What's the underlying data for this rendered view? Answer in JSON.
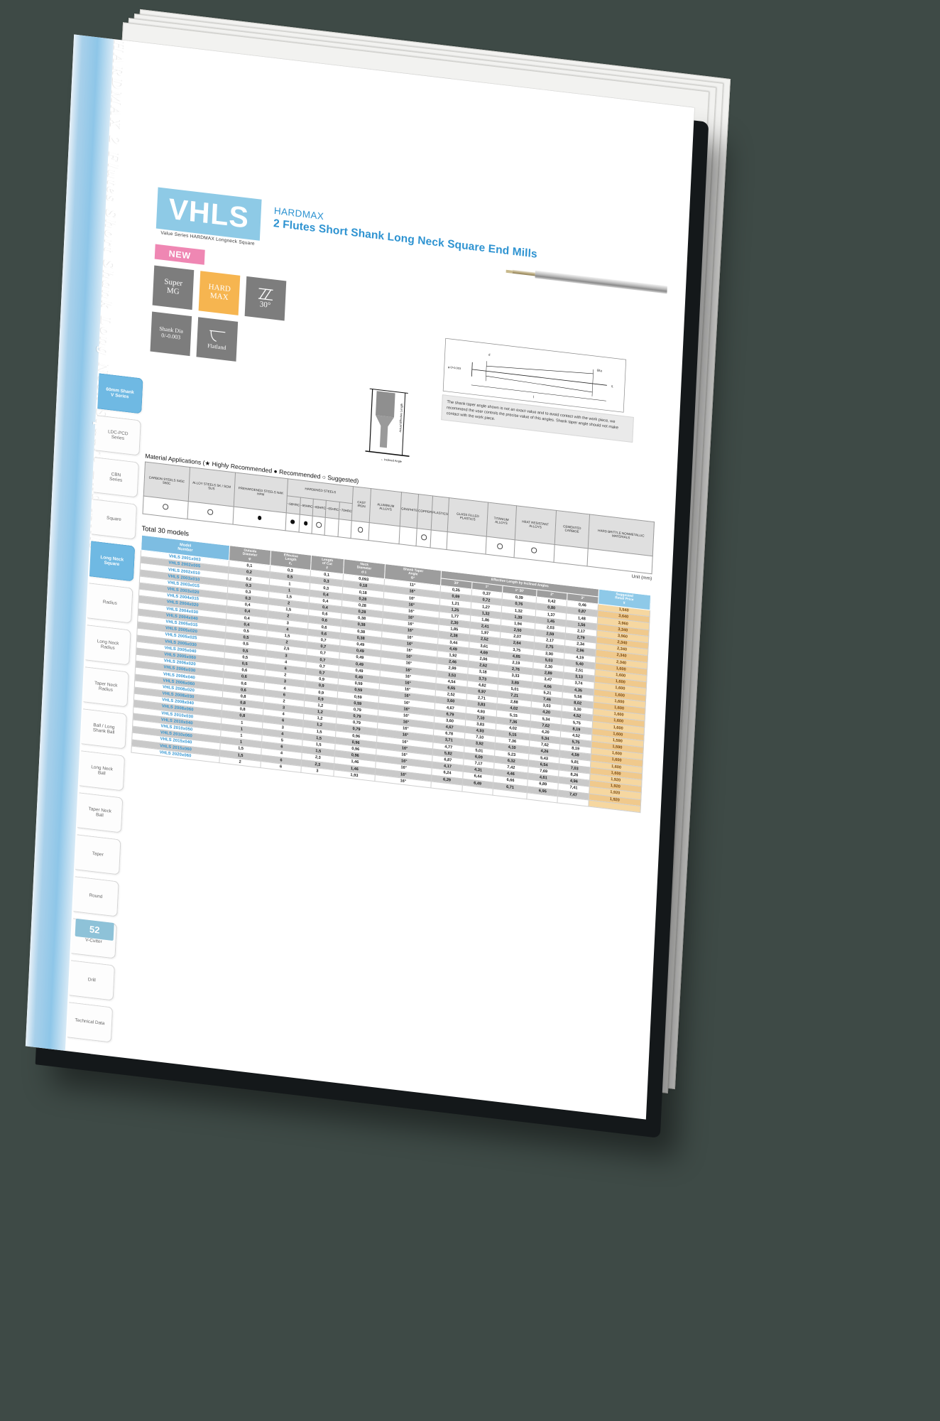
{
  "spine": {
    "text": "HARDMAX 2 Flutes Short Shank Long Neck Square End Mills"
  },
  "page_number": "52",
  "sidebar": {
    "group_labels": [
      "Square",
      "Radius",
      "Ball",
      "Taper"
    ],
    "tabs": [
      {
        "label": "60mm Shank\nV Series",
        "active": true
      },
      {
        "label": "LDC-PCD\nSeries",
        "active": false
      },
      {
        "label": "CBN\nSeries",
        "active": false
      },
      {
        "label": "Square",
        "active": false
      },
      {
        "label": "Long Neck\nSquare",
        "active": true
      },
      {
        "label": "Radius",
        "active": false
      },
      {
        "label": "Long Neck\nRadius",
        "active": false
      },
      {
        "label": "Taper Neck\nRadius",
        "active": false
      },
      {
        "label": "Ball / Long\nShank Ball",
        "active": false
      },
      {
        "label": "Long Neck\nBall",
        "active": false
      },
      {
        "label": "Taper Neck\nBall",
        "active": false
      },
      {
        "label": "Taper",
        "active": false
      },
      {
        "label": "Round",
        "active": false
      },
      {
        "label": "Corner\nV-Cutter",
        "active": false
      },
      {
        "label": "Drill",
        "active": false
      },
      {
        "label": "Technical Data",
        "active": false
      }
    ]
  },
  "header": {
    "logo": "VHLS",
    "logo_sub": "Value Series HARDMAX Longneck Square",
    "brand": "HARDMAX",
    "title": "2 Flutes Short Shank Long Neck Square End Mills",
    "new_badge": "NEW",
    "badges": [
      {
        "name": "super-mg",
        "line1": "Super",
        "line2": "MG",
        "style": "gray"
      },
      {
        "name": "hard-max",
        "line1": "HARD",
        "line2": "MAX",
        "style": "orange"
      },
      {
        "name": "helix-angle",
        "line1": "",
        "line2": "30°",
        "style": "gray",
        "icon": "helix-icon"
      },
      {
        "name": "shank-dia",
        "line1": "Shank Dia",
        "line2": "0/-0.003",
        "style": "gray"
      },
      {
        "name": "flatland",
        "line1": "",
        "line2": "Flatland",
        "style": "gray",
        "icon": "flatland-icon"
      }
    ]
  },
  "diagram": {
    "tool_label": "Actual Effective Length",
    "inclined_label": "Inclined Angle",
    "note": "The shank taper angle shown is not an exact value and to avoid contact with the work piece, we recommend the user controls the precise value of this angles. Shank taper angle should not make contact with the work piece.",
    "dim_d": "d",
    "dim_l1": "l1",
    "dim_l": "l",
    "dim_phi": "φ 0/-0.003",
    "dim_theta": "Θta"
  },
  "material_applications": {
    "title": "Material Applications  (★ Highly Recommended    ● Recommended    ○ Suggested)",
    "legend": [
      {
        "symbol": "★",
        "label": "Highly Recommended"
      },
      {
        "symbol": "●",
        "label": "Recommended"
      },
      {
        "symbol": "○",
        "label": "Suggested"
      }
    ],
    "group_header": "HARDENED STEELS",
    "columns": [
      "CARBON STEELS S45C S50C",
      "ALLOY STEELS SK / SCM SUS",
      "PREHARDENED STEELS NAK HPM",
      "~50HRC",
      "~55HRC",
      "~60HRC",
      "~65HRC",
      "~70HRC",
      "CAST IRON",
      "ALUMINUM ALLOYS",
      "GRAPHITE",
      "COPPER",
      "PLASTICS",
      "GLASS FILLED PLASTICS",
      "TITANIUM ALLOYS",
      "HEAT RESISTANT ALLOYS",
      "CEMENTED CARBIDE",
      "HARD BRITTLE NONMETALLIC MATERIALS"
    ],
    "ratings": [
      "○",
      "○",
      "●",
      "●",
      "●",
      "○",
      "",
      "",
      "○",
      "",
      "",
      "○",
      "",
      "",
      "○",
      "○",
      "",
      ""
    ]
  },
  "unit_note": "Unit  (mm)",
  "total_models": "Total 30 models",
  "table": {
    "headers": {
      "model": "Model\nNumber",
      "outside_diameter": "Outside\nDiameter\nφ",
      "effective_length": "Effective\nLength\nℓ₁",
      "length_of_cut": "Length\nof Cut\nℓ",
      "neck_diameter": "Neck\nDiameter\nd·1",
      "shank_taper_angle": "Shank Taper\nAngle\nΘ°",
      "eff_length_group": "Effective Length by Inclined Angles",
      "angles": [
        "30'",
        "1°",
        "1° 30'",
        "2°",
        "3°"
      ],
      "price": "Suggested\nRetail Price\n¥"
    },
    "rows": [
      {
        "model": "VHLS 2001x003",
        "od": "0,1",
        "el": "0,3",
        "loc": "0,1",
        "nd": "0,093",
        "sta": "11°",
        "a": [
          "0,35",
          "0,37",
          "0,39",
          "0,42",
          "0,46"
        ],
        "price": "1,540"
      },
      {
        "model": "VHLS 2002x005",
        "od": "0,2",
        "el": "0,5",
        "loc": "0,3",
        "nd": "0,18",
        "sta": "16°",
        "a": [
          "0,69",
          "0,72",
          "0,76",
          "0,80",
          "0,87"
        ],
        "price": "3,640"
      },
      {
        "model": "VHLS 2002x010",
        "od": "0,2",
        "el": "1",
        "loc": "0,3",
        "nd": "0,18",
        "sta": "16°",
        "a": [
          "1,21",
          "1,27",
          "1,32",
          "1,37",
          "1,48"
        ],
        "price": "3,960"
      },
      {
        "model": "VHLS 2003x010",
        "od": "0,3",
        "el": "1",
        "loc": "0,4",
        "nd": "0,28",
        "sta": "16°",
        "a": [
          "1,25",
          "1,32",
          "1,39",
          "1,45",
          "1,56"
        ],
        "price": "3,340"
      },
      {
        "model": "VHLS 2003x015",
        "od": "0,3",
        "el": "1,5",
        "loc": "0,4",
        "nd": "0,28",
        "sta": "16°",
        "a": [
          "1,77",
          "1,86",
          "1,94",
          "2,03",
          "2,17"
        ],
        "price": "3,960"
      },
      {
        "model": "VHLS 2003x020",
        "od": "0,3",
        "el": "2",
        "loc": "0,4",
        "nd": "0,28",
        "sta": "16°",
        "a": [
          "2,30",
          "2,41",
          "2,50",
          "2,59",
          "2,79"
        ],
        "price": "2,340"
      },
      {
        "model": "VHLS 2004x015",
        "od": "0,4",
        "el": "1,5",
        "loc": "0,6",
        "nd": "0,38",
        "sta": "16°",
        "a": [
          "1,85",
          "1,97",
          "2,07",
          "2,17",
          "2,34"
        ],
        "price": "2,340"
      },
      {
        "model": "VHLS 2004x020",
        "od": "0,4",
        "el": "2",
        "loc": "0,6",
        "nd": "0,38",
        "sta": "16°",
        "a": [
          "2,38",
          "2,52",
          "2,64",
          "2,75",
          "2,96"
        ],
        "price": "2,340"
      },
      {
        "model": "VHLS 2004x030",
        "od": "0,4",
        "el": "3",
        "loc": "0,6",
        "nd": "0,38",
        "sta": "16°",
        "a": [
          "3,44",
          "3,61",
          "3,75",
          "3,90",
          "4,19"
        ],
        "price": "2,340"
      },
      {
        "model": "VHLS 2004x040",
        "od": "0,4",
        "el": "4",
        "loc": "0,6",
        "nd": "0,38",
        "sta": "16°",
        "a": [
          "4,49",
          "4,69",
          "4,85",
          "5,03",
          "5,40"
        ],
        "price": "1,600"
      },
      {
        "model": "VHLS 2005x015",
        "od": "0,5",
        "el": "1,5",
        "loc": "0,7",
        "nd": "0,49",
        "sta": "16°",
        "a": [
          "1,92",
          "2,06",
          "2,19",
          "2,30",
          "2,51"
        ],
        "price": "1,600"
      },
      {
        "model": "VHLS 2005x020",
        "od": "0,5",
        "el": "2",
        "loc": "0,7",
        "nd": "0,49",
        "sta": "16°",
        "a": [
          "2,46",
          "2,62",
          "2,76",
          "2,89",
          "3,13"
        ],
        "price": "1,600"
      },
      {
        "model": "VHLS 2005x025",
        "od": "0,5",
        "el": "2,5",
        "loc": "0,7",
        "nd": "0,49",
        "sta": "16°",
        "a": [
          "2,99",
          "3,18",
          "3,33",
          "3,47",
          "3,74"
        ],
        "price": "1,600"
      },
      {
        "model": "VHLS 2005x030",
        "od": "0,5",
        "el": "3",
        "loc": "0,7",
        "nd": "0,49",
        "sta": "16°",
        "a": [
          "3,53",
          "3,73",
          "3,89",
          "4,06",
          "4,35"
        ],
        "price": "1,600"
      },
      {
        "model": "VHLS 2005x040",
        "od": "0,5",
        "el": "4",
        "loc": "0,7",
        "nd": "0,49",
        "sta": "16°",
        "a": [
          "4,54",
          "4,82",
          "5,01",
          "5,21",
          "5,58"
        ],
        "price": "1,600"
      },
      {
        "model": "VHLS 2005x060",
        "od": "0,5",
        "el": "6",
        "loc": "0,7",
        "nd": "0,49",
        "sta": "16°",
        "a": [
          "6,65",
          "6,97",
          "7,21",
          "7,46",
          "8,02"
        ],
        "price": "1,600"
      },
      {
        "model": "VHLS 2006x020",
        "od": "0,6",
        "el": "2",
        "loc": "0,9",
        "nd": "0,59",
        "sta": "16°",
        "a": [
          "2,52",
          "2,71",
          "2,88",
          "3,03",
          "3,30"
        ],
        "price": "1,600"
      },
      {
        "model": "VHLS 2006x030",
        "od": "0,6",
        "el": "3",
        "loc": "0,9",
        "nd": "0,59",
        "sta": "16°",
        "a": [
          "3,60",
          "3,83",
          "4,02",
          "4,20",
          "4,52"
        ],
        "price": "1,600"
      },
      {
        "model": "VHLS 2006x040",
        "od": "0,6",
        "el": "4",
        "loc": "0,9",
        "nd": "0,59",
        "sta": "16°",
        "a": [
          "4,67",
          "4,93",
          "5,15",
          "5,34",
          "5,75"
        ],
        "price": "1,600"
      },
      {
        "model": "VHLS 2006x060",
        "od": "0,6",
        "el": "6",
        "loc": "0,9",
        "nd": "0,59",
        "sta": "16°",
        "a": [
          "6,79",
          "7,10",
          "7,36",
          "7,62",
          "8,19"
        ],
        "price": "1,600"
      },
      {
        "model": "VHLS 2008x020",
        "od": "0,8",
        "el": "2",
        "loc": "1,2",
        "nd": "0,79",
        "sta": "16°",
        "a": [
          "3,60",
          "3,83",
          "4,02",
          "4,20",
          "4,52"
        ],
        "price": "1,590"
      },
      {
        "model": "VHLS 2008x030",
        "od": "0,8",
        "el": "3",
        "loc": "1,2",
        "nd": "0,79",
        "sta": "16°",
        "a": [
          "4,67",
          "4,93",
          "5,15",
          "5,34",
          "5,75"
        ],
        "price": "1,590"
      },
      {
        "model": "VHLS 2008x040",
        "od": "0,8",
        "el": "4",
        "loc": "1,2",
        "nd": "0,79",
        "sta": "16°",
        "a": [
          "6,78",
          "7,10",
          "7,36",
          "7,62",
          "8,19"
        ],
        "price": "1,600"
      },
      {
        "model": "VHLS 2008x060",
        "od": "0,8",
        "el": "6",
        "loc": "1,2",
        "nd": "0,79",
        "sta": "16°",
        "a": [
          "3,71",
          "3,92",
          "4,10",
          "4,26",
          "4,59"
        ],
        "price": "1,600"
      },
      {
        "model": "VHLS 2010x030",
        "od": "1",
        "el": "3",
        "loc": "1,5",
        "nd": "0,96",
        "sta": "16°",
        "a": [
          "4,77",
          "5,01",
          "5,23",
          "5,43",
          "5,81"
        ],
        "price": "1,600"
      },
      {
        "model": "VHLS 2010x040",
        "od": "1",
        "el": "4",
        "loc": "1,5",
        "nd": "0,96",
        "sta": "16°",
        "a": [
          "5,82",
          "6,09",
          "6,32",
          "6,54",
          "7,03"
        ],
        "price": "1,600"
      },
      {
        "model": "VHLS 2010x050",
        "od": "1",
        "el": "5",
        "loc": "1,5",
        "nd": "0,96",
        "sta": "16°",
        "a": [
          "6,87",
          "7,17",
          "7,42",
          "7,69",
          "8,26"
        ],
        "price": "1,920"
      },
      {
        "model": "VHLS 2010x060",
        "od": "1",
        "el": "6",
        "loc": "1,5",
        "nd": "0,96",
        "sta": "16°",
        "a": [
          "4,17",
          "4,31",
          "4,46",
          "4,61",
          "4,96"
        ],
        "price": "1,920"
      },
      {
        "model": "VHLS 2015x040",
        "od": "1,5",
        "el": "4",
        "loc": "2,3",
        "nd": "1,46",
        "sta": "16°",
        "a": [
          "6,24",
          "6,44",
          "6,66",
          "6,89",
          "7,41"
        ],
        "price": "1,920"
      },
      {
        "model": "VHLS 2015x060",
        "od": "1,5",
        "el": "6",
        "loc": "2,3",
        "nd": "1,46",
        "sta": "16°",
        "a": [
          "6,29",
          "6,49",
          "6,71",
          "6,95",
          "7,47"
        ],
        "price": "1,920"
      },
      {
        "model": "VHLS 2020x060",
        "od": "2",
        "el": "6",
        "loc": "3",
        "nd": "1,93",
        "sta": "16°",
        "a": [
          "",
          "",
          "",
          "",
          ""
        ],
        "price": ""
      }
    ]
  }
}
